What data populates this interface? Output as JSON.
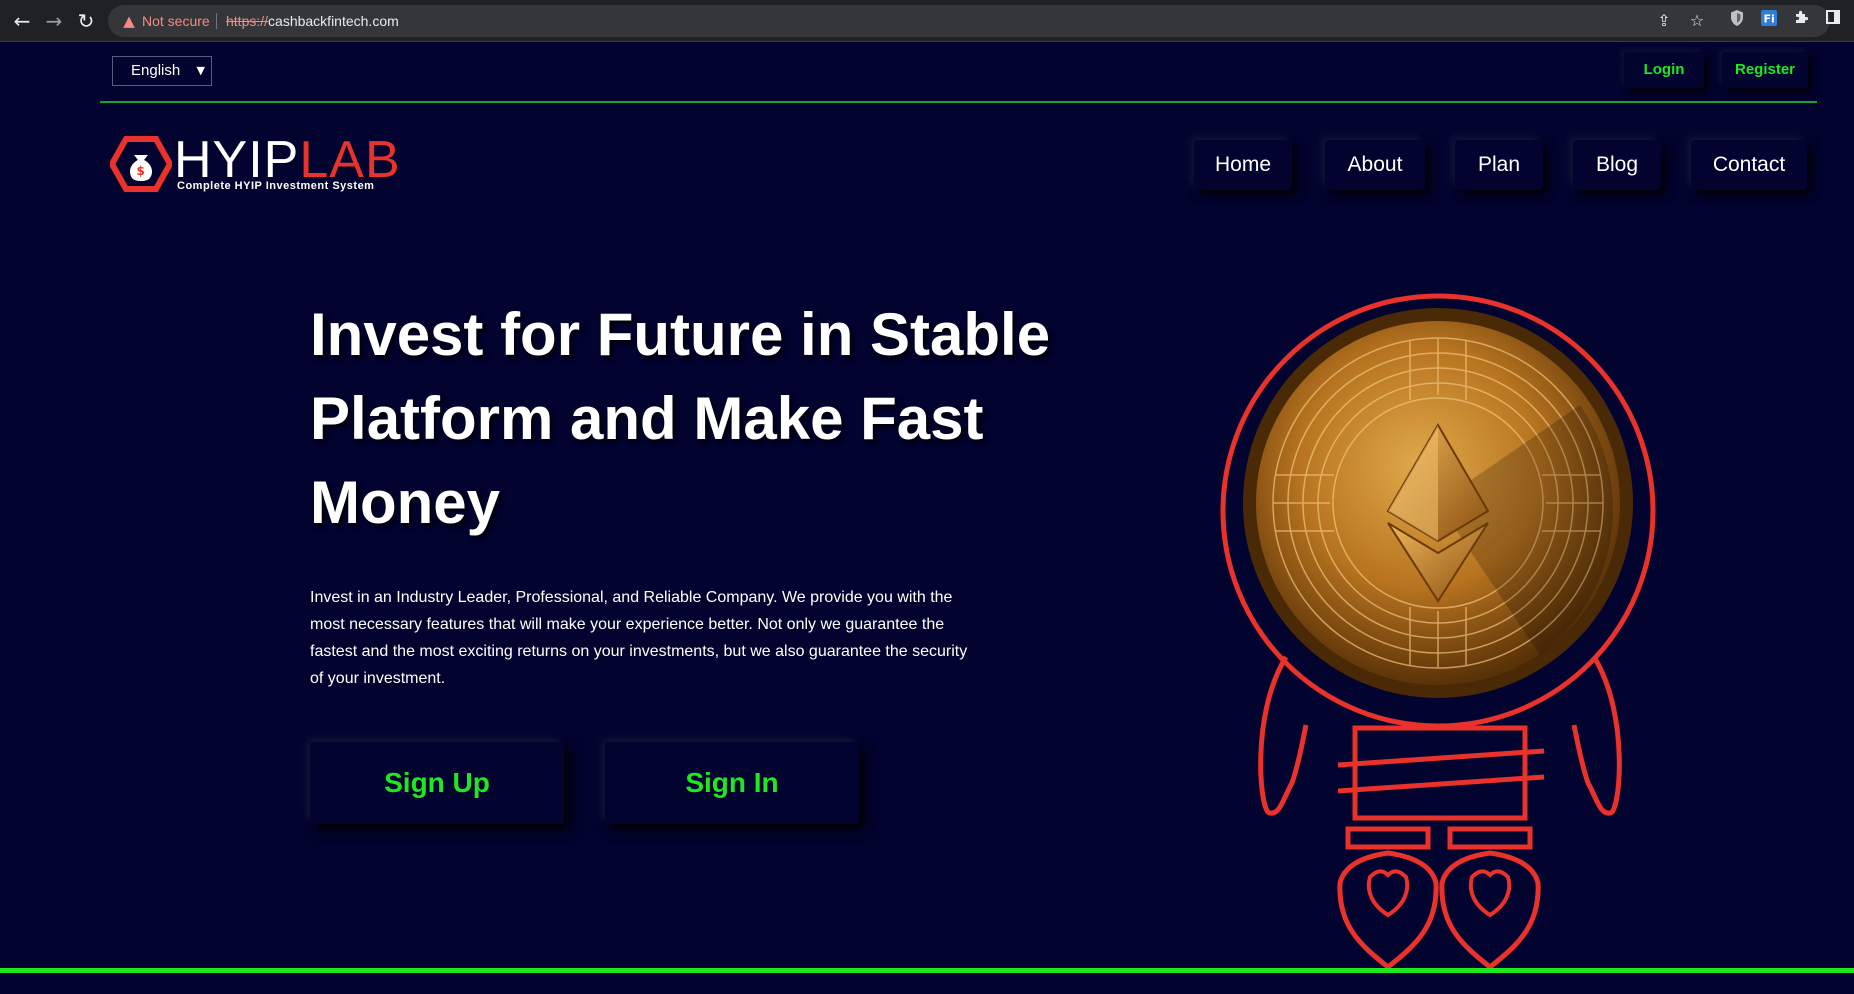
{
  "browser": {
    "security_label": "Not secure",
    "url_scheme": "https://",
    "url_host": "cashbackfintech.com",
    "icons": [
      "back-arrow-icon",
      "forward-arrow-icon",
      "reload-icon",
      "warning-icon",
      "share-icon",
      "star-icon",
      "shield-icon",
      "extension-fi-icon",
      "puzzle-icon",
      "sidebar-icon"
    ]
  },
  "topbar": {
    "language": "English",
    "login_label": "Login",
    "register_label": "Register"
  },
  "logo": {
    "text_main": "HYIP",
    "text_accent": "LAB",
    "tagline": "Complete HYIP Investment System"
  },
  "nav": {
    "items": [
      {
        "label": "Home"
      },
      {
        "label": "About"
      },
      {
        "label": "Plan"
      },
      {
        "label": "Blog"
      },
      {
        "label": "Contact"
      }
    ]
  },
  "hero": {
    "title": "Invest for Future in Stable Platform and Make Fast Money",
    "description": "Invest in an Industry Leader, Professional, and Reliable Company. We provide you with the most necessary features that will make your experience better. Not only we guarantee the fastest and the most exciting returns on your investments, but we also guarantee the security of your investment.",
    "signup_label": "Sign Up",
    "signin_label": "Sign In"
  },
  "colors": {
    "background": "#02032e",
    "accent_green": "#1ee81e",
    "accent_red": "#e8322b",
    "coin_gold": "#c98a2e"
  }
}
